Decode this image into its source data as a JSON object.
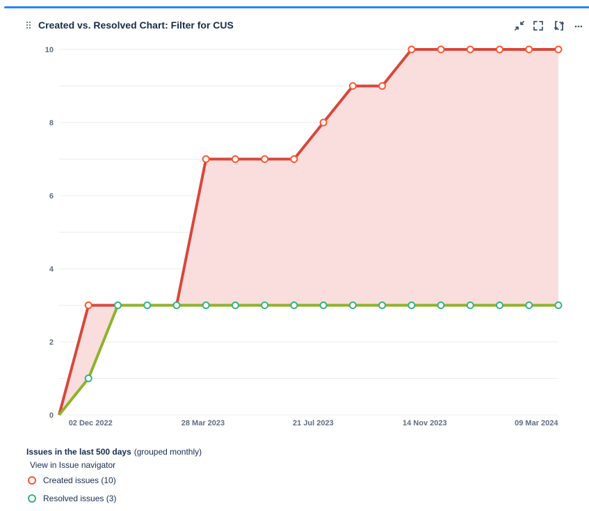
{
  "header": {
    "title": "Created vs. Resolved Chart: Filter for CUS"
  },
  "icons": {
    "drag": "drag-handle-icon",
    "collapse": "collapse-icon",
    "fullscreen": "fullscreen-icon",
    "refresh": "refresh-icon",
    "more": "more-icon"
  },
  "colors": {
    "accent": "#2684ff",
    "created": "#d8473b",
    "resolved": "#8db32a",
    "resolved_marker": "#36b37e",
    "created_marker": "#ff5630",
    "fill": "#f9dedd"
  },
  "legend": {
    "title": "Issues in the last 500 days",
    "subtitle": "(grouped monthly)",
    "nav_link": "View in Issue navigator",
    "created_label": "Created issues (10)",
    "resolved_label": "Resolved issues (3)"
  },
  "chart_data": {
    "type": "line",
    "title": "",
    "xlabel": "",
    "ylabel": "",
    "ylim": [
      0,
      10
    ],
    "yticks": [
      "0",
      "2",
      "4",
      "6",
      "8",
      "10"
    ],
    "xticks": [
      "02 Dec 2022",
      "28 Mar 2023",
      "21 Jul 2023",
      "14 Nov 2023",
      "09 Mar 2024"
    ],
    "x": [
      "2022-11",
      "2022-12",
      "2023-01",
      "2023-02",
      "2023-03",
      "2023-04",
      "2023-05",
      "2023-06",
      "2023-07",
      "2023-08",
      "2023-09",
      "2023-10",
      "2023-11",
      "2023-12",
      "2024-01",
      "2024-02",
      "2024-03",
      "2024-04"
    ],
    "series": [
      {
        "name": "Created issues",
        "values": [
          0,
          3,
          3,
          3,
          3,
          7,
          7,
          7,
          7,
          8,
          9,
          9,
          10,
          10,
          10,
          10,
          10,
          10
        ]
      },
      {
        "name": "Resolved issues",
        "values": [
          0,
          1,
          3,
          3,
          3,
          3,
          3,
          3,
          3,
          3,
          3,
          3,
          3,
          3,
          3,
          3,
          3,
          3
        ]
      }
    ],
    "grid": true,
    "legend_position": "bottom-left"
  }
}
